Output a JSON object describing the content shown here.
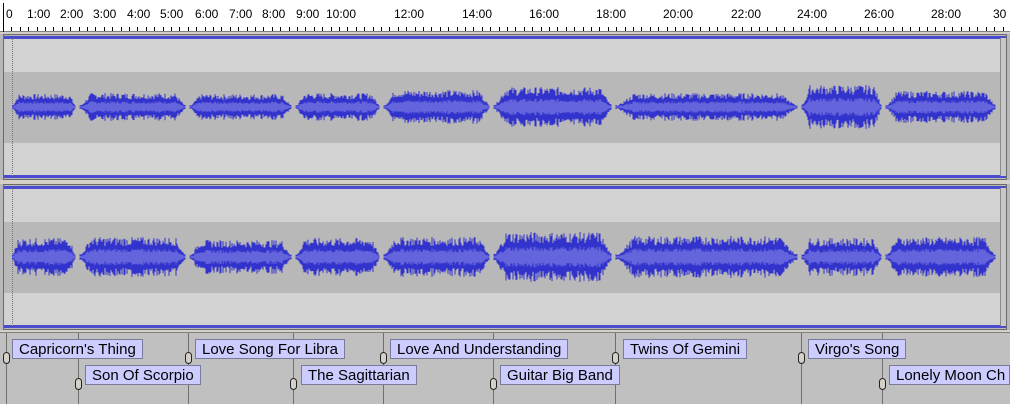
{
  "ruler": {
    "ticks": [
      "0",
      "1:00",
      "2:00",
      "3:00",
      "4:00",
      "5:00",
      "6:00",
      "7:00",
      "8:00",
      "9:00",
      "10:00",
      "12:00",
      "14:00",
      "16:00",
      "18:00",
      "20:00",
      "22:00",
      "24:00",
      "26:00",
      "28:00",
      "30"
    ]
  },
  "colors": {
    "waveform": "#3232cd",
    "waveform_rms": "#6464dc",
    "label_fill": "#ccccff"
  },
  "tracks": [
    {
      "channel": "upper"
    },
    {
      "channel": "lower"
    }
  ],
  "labels": {
    "row1": [
      "Capricorn's Thing",
      "Love Song For Libra",
      "Love And Understanding",
      "Twins Of Gemini",
      "Virgo's Song"
    ],
    "row2": [
      "Son Of Scorpio",
      "The Sagittarian",
      "Guitar Big Band",
      "Lonely Moon Ch"
    ]
  }
}
